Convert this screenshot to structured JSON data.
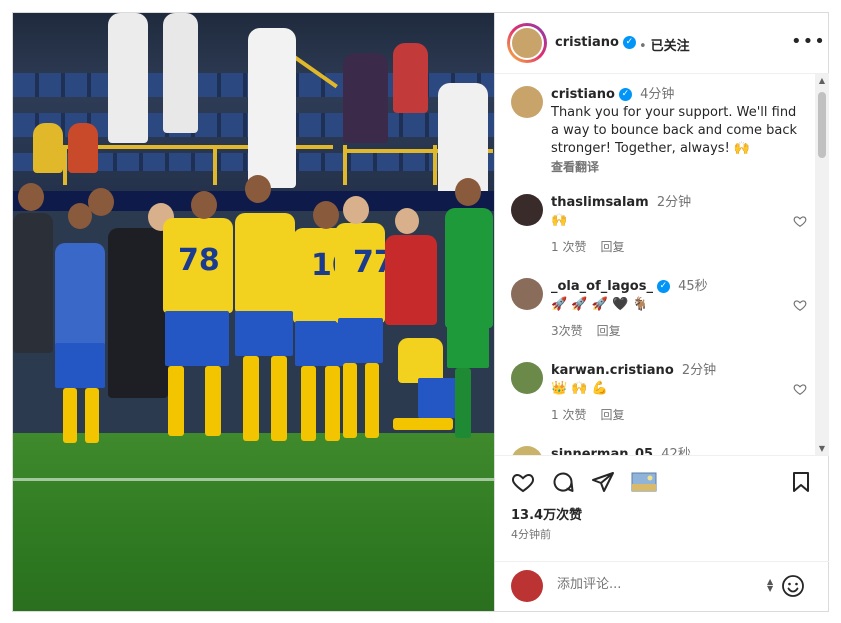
{
  "post": {
    "author": "cristiano",
    "follow_label": "已关注",
    "more_label": "•••"
  },
  "caption": {
    "username": "cristiano",
    "time": "4分钟",
    "text": "Thank you for your support. We'll find a way to bounce back and come back stronger! Together, always! 🙌",
    "translate": "查看翻译"
  },
  "comments": [
    {
      "username": "thaslimsalam",
      "time": "2分钟",
      "text": "🙌",
      "likes": "1 次赞",
      "reply": "回复",
      "verified": false
    },
    {
      "username": "_ola_of_lagos_",
      "time": "45秒",
      "text": "🚀 🚀 🚀 🖤 🐐",
      "likes": "3次赞",
      "reply": "回复",
      "verified": true
    },
    {
      "username": "karwan.cristiano",
      "time": "2分钟",
      "text": "👑 🙌 💪",
      "likes": "1 次赞",
      "reply": "回复",
      "verified": false
    },
    {
      "username": "sinnerman_05",
      "time": "42秒",
      "text": "",
      "likes": "",
      "reply": "",
      "verified": false
    }
  ],
  "stats": {
    "likes": "13.4万次赞",
    "posted": "4分钟前"
  },
  "add_comment": {
    "placeholder": "添加评论..."
  },
  "icons": [
    "heart-icon",
    "comment-icon",
    "share-icon",
    "image-icon",
    "bookmark-icon",
    "emoji-icon",
    "verified-icon",
    "more-icon"
  ],
  "colors": {
    "verified": "#0095f6",
    "text": "#262626",
    "muted": "#737373"
  }
}
